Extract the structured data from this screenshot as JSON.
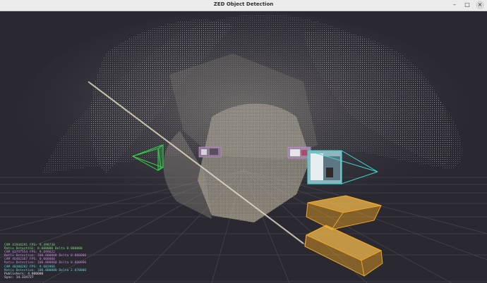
{
  "window": {
    "title": "ZED Object Detection",
    "minimize_glyph": "–",
    "maximize_glyph": "□",
    "close_glyph": "×"
  },
  "overlay": {
    "lines": [
      {
        "text": "CAM 41944291 FPS: 9.498738",
        "color": "#7fd87f"
      },
      {
        "text": "Ratio Detection: 0.000000 Delta 0.000000",
        "color": "#7fd87f"
      },
      {
        "text": "CAM 43737554 FPS: 9.699622",
        "color": "#c58ad8"
      },
      {
        "text": "Ratio Detection: 100.000000 Delta 0.000000",
        "color": "#c58ad8"
      },
      {
        "text": "CAM 46482367 FPS: 0.000000",
        "color": "#c58ad8"
      },
      {
        "text": "Ratio Detection: 100.000000 Delta 0.000000",
        "color": "#c58ad8"
      },
      {
        "text": "CAM 40300282 FPS: 9.603966",
        "color": "#5ad6d6"
      },
      {
        "text": "Ratio Detection: 100.000000 Delta 2.070000",
        "color": "#5ad6d6"
      },
      {
        "text": "Publishers: 4.000000",
        "color": "#e0e0e0"
      },
      {
        "text": "Sync: 14.334727",
        "color": "#e0e0e0"
      }
    ]
  },
  "colors": {
    "green_camera": "#35d44a",
    "cyan_camera": "#3fd6d0",
    "object_box": "#f0a522",
    "grid": "#5b5a66",
    "point_cloud": "#c9c6bc"
  }
}
